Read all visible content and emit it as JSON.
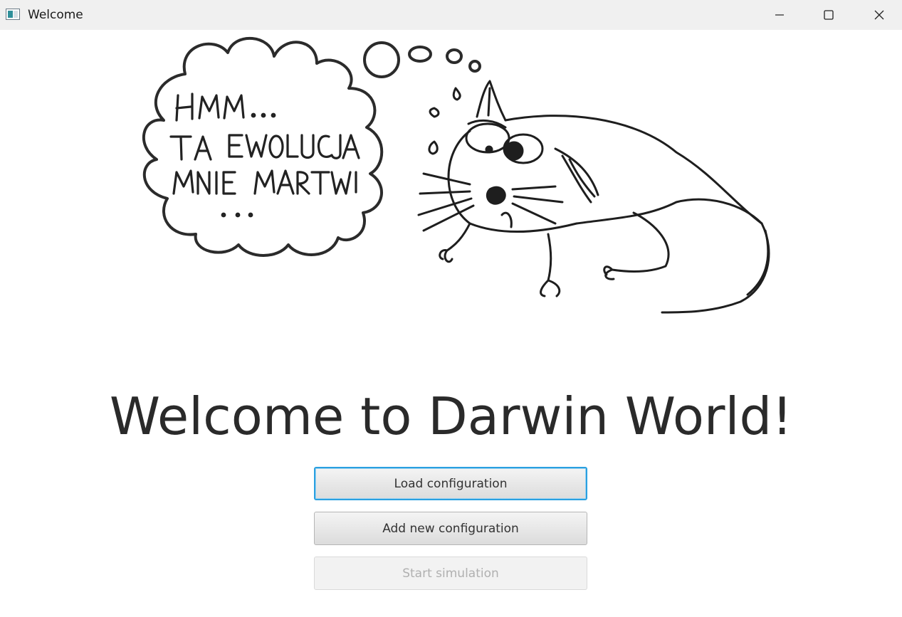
{
  "window": {
    "title": "Welcome",
    "icon": "app-window-icon",
    "controls": [
      "minimize-icon",
      "maximize-icon",
      "close-icon"
    ]
  },
  "illustration": {
    "description_icon": "worried-rat-drawing",
    "speech_bubble_lines": [
      "HMM...",
      "TA EWOLUCJA",
      "MNIE MARTWI",
      "..."
    ]
  },
  "main": {
    "heading": "Welcome to Darwin World!",
    "buttons": {
      "load": "Load configuration",
      "add": "Add new configuration",
      "start": "Start simulation"
    },
    "start_enabled": false
  },
  "colors": {
    "focus_ring": "#2aa0e0",
    "heading": "#2a2a2a",
    "disabled_text": "#b0b0b0"
  }
}
